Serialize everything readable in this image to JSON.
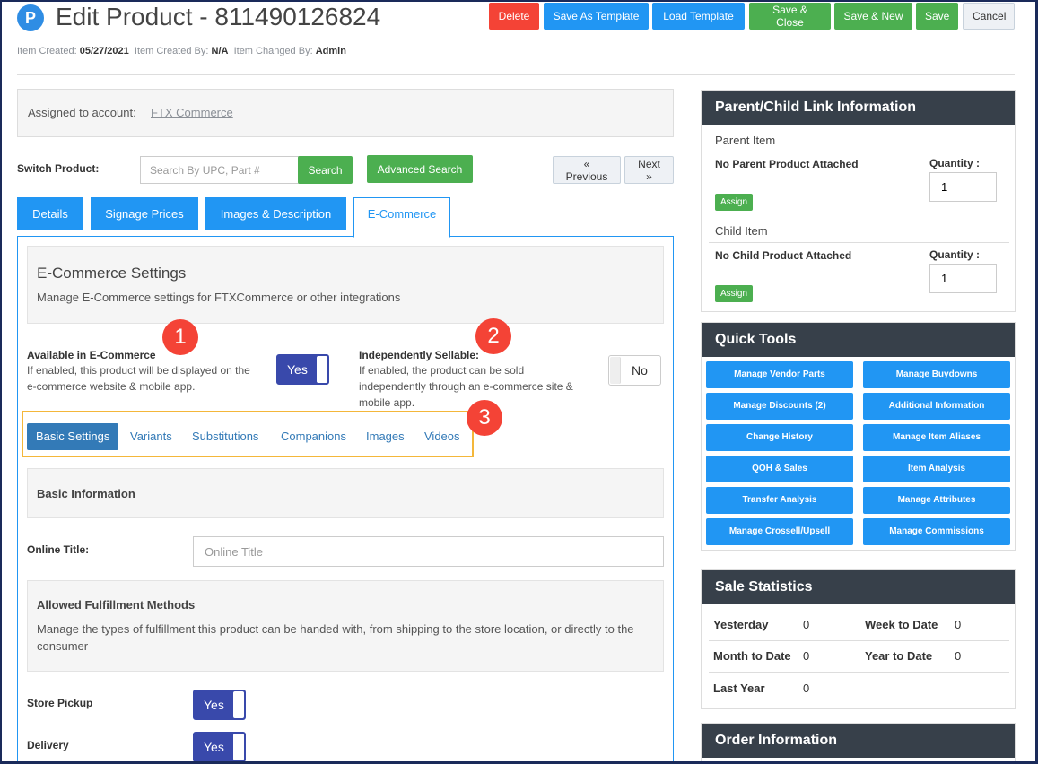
{
  "header": {
    "logo": "P",
    "title": "Edit Product - 811490126824",
    "buttons": {
      "delete": "Delete",
      "save_template": "Save As Template",
      "load_template": "Load Template",
      "save_close": "Save & Close",
      "save_new": "Save & New",
      "save": "Save",
      "cancel": "Cancel"
    },
    "meta": {
      "created_label": "Item Created:",
      "created_value": "05/27/2021",
      "created_by_label": "Item Created By:",
      "created_by_value": "N/A",
      "changed_by_label": "Item Changed By:",
      "changed_by_value": "Admin"
    }
  },
  "account": {
    "label": "Assigned to account:",
    "value": "FTX Commerce"
  },
  "switch_product": {
    "label": "Switch Product:",
    "placeholder": "Search By UPC, Part #",
    "search": "Search",
    "advanced": "Advanced Search",
    "previous": "« Previous",
    "next": "Next »"
  },
  "tabs": [
    {
      "label": "Details"
    },
    {
      "label": "Signage Prices"
    },
    {
      "label": "Images & Description"
    },
    {
      "label": "E-Commerce"
    }
  ],
  "ecommerce": {
    "title": "E-Commerce Settings",
    "subtitle": "Manage E-Commerce settings for FTXCommerce or other integrations",
    "available": {
      "title": "Available in E-Commerce",
      "desc": "If enabled, this product will be displayed on the e-commerce website & mobile app.",
      "value": "Yes"
    },
    "sellable": {
      "title": "Independently Sellable:",
      "desc": "If enabled, the product can be sold independently through an e-commerce site & mobile app.",
      "value": "No"
    },
    "badges": [
      "1",
      "2",
      "3"
    ],
    "subtabs": [
      "Basic Settings",
      "Variants",
      "Substitutions",
      "Companions",
      "Images",
      "Videos"
    ],
    "basic_info": "Basic Information",
    "online_title_label": "Online Title:",
    "online_title_placeholder": "Online Title",
    "fulfillment_title": "Allowed Fulfillment Methods",
    "fulfillment_desc": "Manage the types of fulfillment this product can be handed with, from shipping to the store location, or directly to the consumer",
    "store_pickup_label": "Store Pickup",
    "store_pickup_value": "Yes",
    "delivery_label": "Delivery",
    "delivery_value": "Yes"
  },
  "parent_child": {
    "title": "Parent/Child Link Information",
    "parent_label": "Parent Item",
    "parent_status": "No Parent Product Attached",
    "child_label": "Child Item",
    "child_status": "No Child Product Attached",
    "quantity_label": "Quantity :",
    "parent_qty": "1",
    "child_qty": "1",
    "assign": "Assign"
  },
  "quick_tools": {
    "title": "Quick Tools",
    "buttons": [
      "Manage Vendor Parts",
      "Manage Buydowns",
      "Manage Discounts (2)",
      "Additional Information",
      "Change History",
      "Manage Item Aliases",
      "QOH & Sales",
      "Item Analysis",
      "Transfer Analysis",
      "Manage Attributes",
      "Manage Crossell/Upsell",
      "Manage Commissions"
    ]
  },
  "sale_statistics": {
    "title": "Sale Statistics",
    "rows": [
      {
        "label": "Yesterday",
        "value": "0"
      },
      {
        "label": "Week to Date",
        "value": "0"
      },
      {
        "label": "Month to Date",
        "value": "0"
      },
      {
        "label": "Year to Date",
        "value": "0"
      },
      {
        "label": "Last Year",
        "value": "0"
      }
    ]
  },
  "order_info": {
    "title": "Order Information"
  }
}
